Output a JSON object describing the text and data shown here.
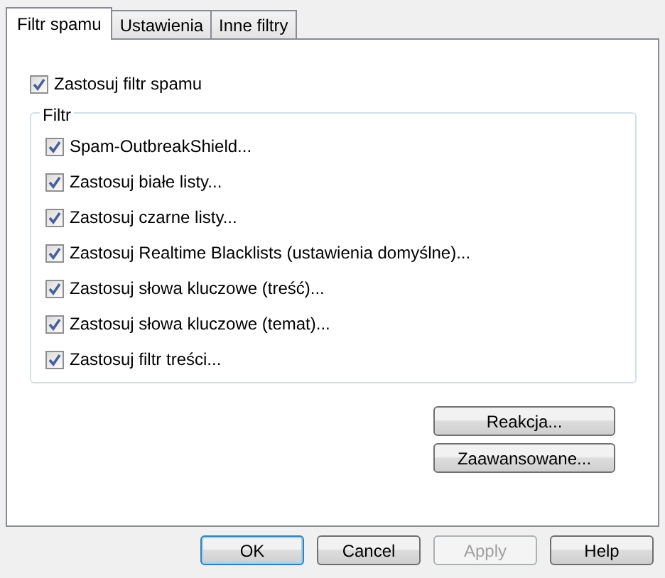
{
  "tabs": [
    {
      "label": "Filtr spamu",
      "selected": true
    },
    {
      "label": "Ustawienia",
      "selected": false
    },
    {
      "label": "Inne filtry",
      "selected": false
    }
  ],
  "master_option": {
    "label": "Zastosuj filtr spamu",
    "checked": true
  },
  "filter_group": {
    "title": "Filtr",
    "options": [
      {
        "label": "Spam-OutbreakShield...",
        "checked": true
      },
      {
        "label": "Zastosuj białe listy...",
        "checked": true
      },
      {
        "label": "Zastosuj czarne listy...",
        "checked": true
      },
      {
        "label": "Zastosuj Realtime Blacklists (ustawienia domyślne)...",
        "checked": true
      },
      {
        "label": "Zastosuj słowa kluczowe (treść)...",
        "checked": true
      },
      {
        "label": "Zastosuj słowa kluczowe (temat)...",
        "checked": true
      },
      {
        "label": "Zastosuj filtr treści...",
        "checked": true
      }
    ]
  },
  "side_buttons": [
    {
      "label": "Reakcja..."
    },
    {
      "label": "Zaawansowane..."
    }
  ],
  "dialog_buttons": [
    {
      "label": "OK",
      "default": true,
      "disabled": false
    },
    {
      "label": "Cancel",
      "default": false,
      "disabled": false
    },
    {
      "label": "Apply",
      "default": false,
      "disabled": true
    },
    {
      "label": "Help",
      "default": false,
      "disabled": false
    }
  ]
}
